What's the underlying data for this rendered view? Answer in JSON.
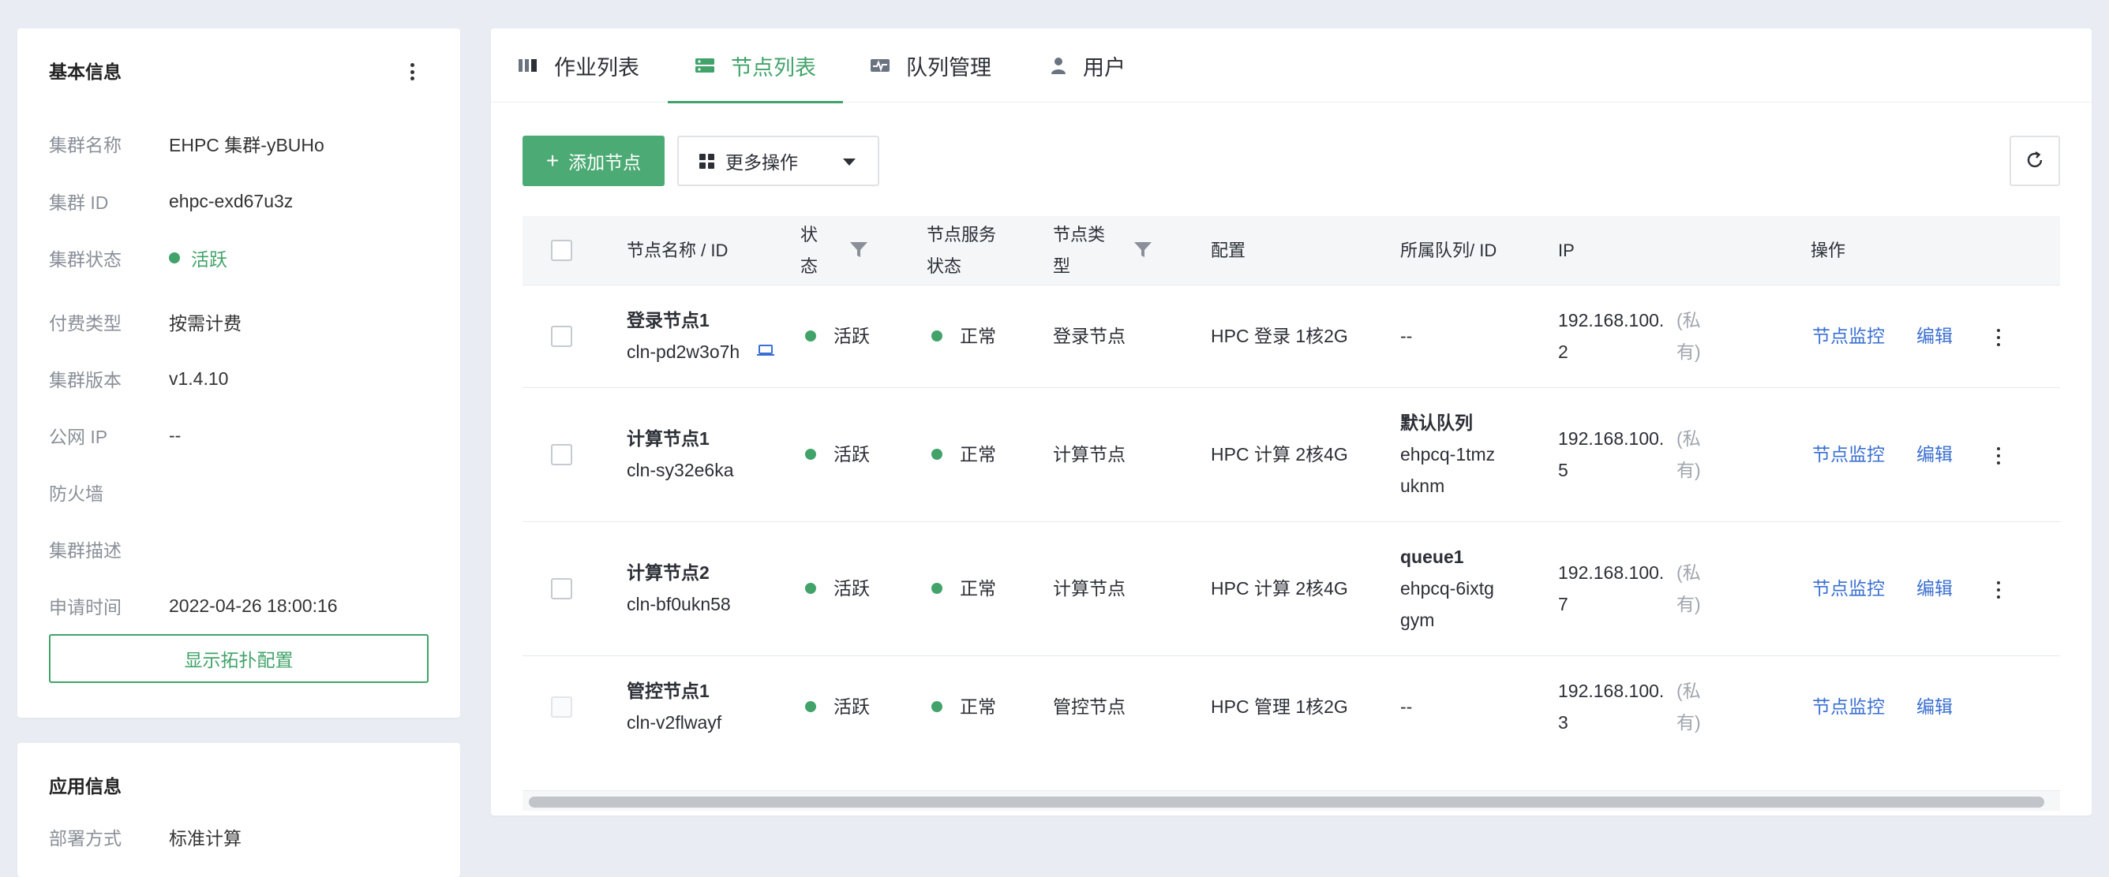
{
  "basic_info": {
    "title": "基本信息",
    "rows": [
      {
        "label": "集群名称",
        "value": "EHPC 集群-yBUHo"
      },
      {
        "label": "集群 ID",
        "value": "ehpc-exd67u3z"
      },
      {
        "label": "集群状态",
        "value": "活跃"
      },
      {
        "label": "付费类型",
        "value": "按需计费"
      },
      {
        "label": "集群版本",
        "value": "v1.4.10"
      },
      {
        "label": "公网 IP",
        "value": "--"
      },
      {
        "label": "防火墙",
        "value": ""
      },
      {
        "label": "集群描述",
        "value": ""
      },
      {
        "label": "申请时间",
        "value": "2022-04-26 18:00:16"
      }
    ],
    "topology_button": "显示拓扑配置"
  },
  "app_info": {
    "title": "应用信息",
    "rows": [
      {
        "label": "部署方式",
        "value": "标准计算"
      }
    ]
  },
  "tabs": [
    {
      "label": "作业列表",
      "icon": "columns-icon"
    },
    {
      "label": "节点列表",
      "icon": "server-icon"
    },
    {
      "label": "队列管理",
      "icon": "monitor-pulse-icon"
    },
    {
      "label": "用户",
      "icon": "user-icon"
    }
  ],
  "toolbar": {
    "add_node_label": "添加节点",
    "more_ops_label": "更多操作"
  },
  "table": {
    "headers": {
      "name": "节点名称 / ID",
      "status_line1": "状",
      "status_line2": "态",
      "service_line1": "节点服务",
      "service_line2": "状态",
      "type_line1": "节点类",
      "type_line2": "型",
      "config": "配置",
      "queue": "所属队列/ ID",
      "ip": "IP",
      "actions": "操作"
    },
    "rows": [
      {
        "name": "登录节点1",
        "id": "cln-pd2w3o7h",
        "status": "活跃",
        "service_status": "正常",
        "type": "登录节点",
        "config": "HPC 登录 1核2G",
        "queue_name": "",
        "queue_id_1": "--",
        "queue_id_2": "",
        "ip_1": "192.168.100.",
        "ip_2": "2",
        "ip_tag_1": "(私",
        "ip_tag_2": "有)",
        "monitor": "节点监控",
        "edit": "编辑"
      },
      {
        "name": "计算节点1",
        "id": "cln-sy32e6ka",
        "status": "活跃",
        "service_status": "正常",
        "type": "计算节点",
        "config": "HPC 计算 2核4G",
        "queue_name": "默认队列",
        "queue_id_1": "ehpcq-1tmz",
        "queue_id_2": "uknm",
        "ip_1": "192.168.100.",
        "ip_2": "5",
        "ip_tag_1": "(私",
        "ip_tag_2": "有)",
        "monitor": "节点监控",
        "edit": "编辑"
      },
      {
        "name": "计算节点2",
        "id": "cln-bf0ukn58",
        "status": "活跃",
        "service_status": "正常",
        "type": "计算节点",
        "config": "HPC 计算 2核4G",
        "queue_name": "queue1",
        "queue_id_1": "ehpcq-6ixtg",
        "queue_id_2": "gym",
        "ip_1": "192.168.100.",
        "ip_2": "7",
        "ip_tag_1": "(私",
        "ip_tag_2": "有)",
        "monitor": "节点监控",
        "edit": "编辑"
      },
      {
        "name": "管控节点1",
        "id": "cln-v2flwayf",
        "status": "活跃",
        "service_status": "正常",
        "type": "管控节点",
        "config": "HPC 管理 1核2G",
        "queue_name": "",
        "queue_id_1": "--",
        "queue_id_2": "",
        "ip_1": "192.168.100.",
        "ip_2": "3",
        "ip_tag_1": "(私",
        "ip_tag_2": "有)",
        "monitor": "节点监控",
        "edit": "编辑"
      }
    ]
  },
  "colors": {
    "accent": "#41a36a",
    "link": "#3a6fd2",
    "background": "#e9edf3"
  }
}
